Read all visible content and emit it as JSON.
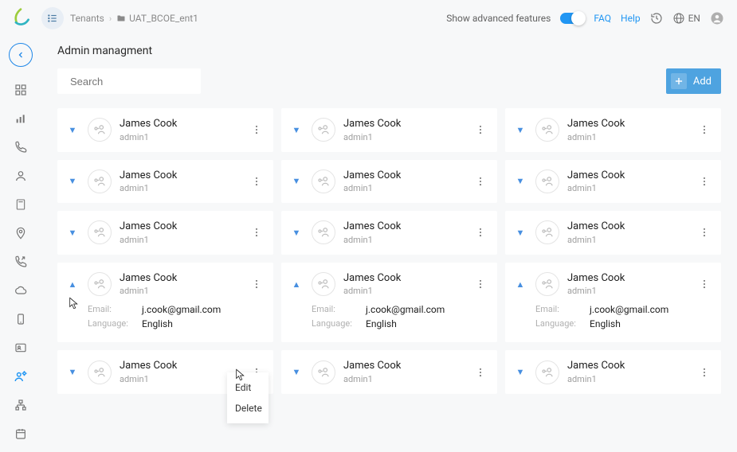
{
  "breadcrumb": {
    "root": "Tenants",
    "current": "UAT_BCOE_ent1"
  },
  "header": {
    "advanced_label": "Show advanced features",
    "faq": "FAQ",
    "help": "Help",
    "lang": "EN"
  },
  "page_title": "Admin managment",
  "search": {
    "placeholder": "Search"
  },
  "add_label": "Add",
  "detail_labels": {
    "email": "Email:",
    "language": "Language:"
  },
  "menu": {
    "edit": "Edit",
    "delete": "Delete"
  },
  "users": [
    {
      "name": "James Cook",
      "role": "admin1",
      "expanded": false
    },
    {
      "name": "James Cook",
      "role": "admin1",
      "expanded": false
    },
    {
      "name": "James Cook",
      "role": "admin1",
      "expanded": false
    },
    {
      "name": "James Cook",
      "role": "admin1",
      "expanded": false
    },
    {
      "name": "James Cook",
      "role": "admin1",
      "expanded": false
    },
    {
      "name": "James Cook",
      "role": "admin1",
      "expanded": false
    },
    {
      "name": "James Cook",
      "role": "admin1",
      "expanded": false
    },
    {
      "name": "James Cook",
      "role": "admin1",
      "expanded": false
    },
    {
      "name": "James Cook",
      "role": "admin1",
      "expanded": false
    },
    {
      "name": "James Cook",
      "role": "admin1",
      "expanded": true,
      "email": "j.cook@gmail.com",
      "language": "English"
    },
    {
      "name": "James Cook",
      "role": "admin1",
      "expanded": true,
      "email": "j.cook@gmail.com",
      "language": "English"
    },
    {
      "name": "James Cook",
      "role": "admin1",
      "expanded": true,
      "email": "j.cook@gmail.com",
      "language": "English"
    },
    {
      "name": "James Cook",
      "role": "admin1",
      "expanded": false,
      "menu_open": true
    },
    {
      "name": "James Cook",
      "role": "admin1",
      "expanded": false
    },
    {
      "name": "James Cook",
      "role": "admin1",
      "expanded": false
    }
  ]
}
